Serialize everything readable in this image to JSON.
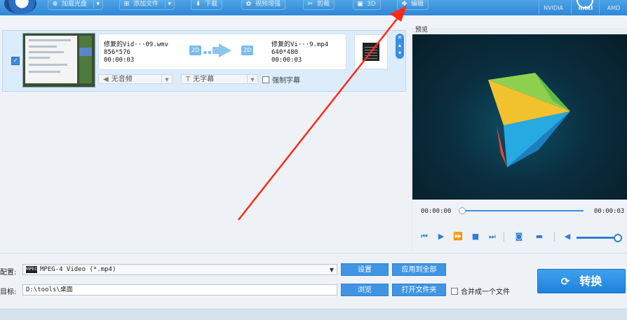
{
  "toolbar": {
    "items": [
      {
        "label": "加载光盘",
        "icon": "disc-add-icon"
      },
      {
        "label": "添加文件",
        "icon": "file-add-icon"
      },
      {
        "label": "下载",
        "icon": "download-icon"
      },
      {
        "label": "视频增强",
        "icon": "enhance-icon"
      },
      {
        "label": "剪裁",
        "icon": "scissors-icon"
      },
      {
        "label": "3D",
        "icon": "3d-icon"
      },
      {
        "label": "编辑",
        "icon": "edit-icon"
      }
    ],
    "hardware": [
      "NVIDIA",
      "intel",
      "AMD"
    ]
  },
  "file_item": {
    "checked": true,
    "source": {
      "name": "修复的Vid···09.wmv",
      "resolution": "856*576",
      "duration": "00:00:03"
    },
    "output": {
      "name": "修复的Vi···9.mp4",
      "resolution": "640*480",
      "duration": "00:00:03"
    },
    "badge_in": "2D",
    "badge_out": "2D",
    "audio": "无音频",
    "subtitle": "无字幕",
    "force_subtitle": "强制字幕"
  },
  "preview": {
    "label": "预览",
    "time_current": "00:00:00",
    "time_total": "00:00:03"
  },
  "bottom": {
    "profile_label": "配置:",
    "profile_icon_text": "MPEG",
    "profile_value": "MPEG-4 Video (*.mp4)",
    "settings_button": "设置",
    "apply_all_button": "应用到全部",
    "target_label": "目标:",
    "target_value": "D:\\tools\\桌面",
    "browse_button": "浏览",
    "open_folder_button": "打开文件夹",
    "merge_label": "合并成一个文件",
    "convert_button": "转换"
  },
  "colors": {
    "accent": "#3f95e4",
    "annotation_arrow": "#ff2a1a"
  }
}
